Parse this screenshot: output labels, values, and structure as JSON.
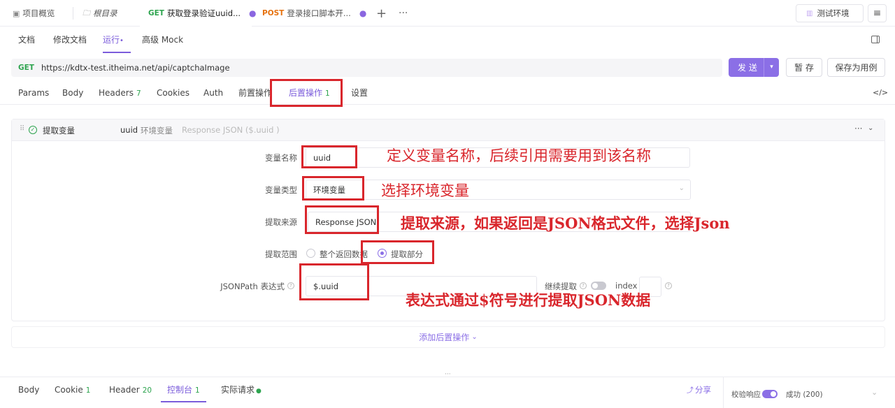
{
  "top_tabs": [
    {
      "icon": "overview-icon",
      "label": "项目概览"
    },
    {
      "icon": "folder-icon",
      "label": "根目录"
    },
    {
      "method": "GET",
      "label": "获取登录验证uuid..."
    },
    {
      "method": "POST",
      "label": "登录接口脚本开..."
    }
  ],
  "env": {
    "label": "测试环境"
  },
  "sub_tabs": [
    "文档",
    "修改文档",
    "运行",
    "高级 Mock"
  ],
  "active_sub_tab_dot": "•",
  "url": {
    "method": "GET",
    "value": "https://kdtx-test.itheima.net/api/captchaImage"
  },
  "buttons": {
    "send": "发 送",
    "save_temp": "暂 存",
    "save_case": "保存为用例"
  },
  "req_tabs": [
    {
      "label": "Params"
    },
    {
      "label": "Body"
    },
    {
      "label": "Headers",
      "count": "7"
    },
    {
      "label": "Cookies"
    },
    {
      "label": "Auth"
    },
    {
      "label": "前置操作"
    },
    {
      "label": "后置操作",
      "count": "1"
    },
    {
      "label": "设置"
    }
  ],
  "extract": {
    "title": "提取变量",
    "summary_var": "uuid",
    "summary_type": "环境变量",
    "summary_expr": "Response JSON ($.uuid )",
    "var_name_label": "变量名称",
    "var_name_value": "uuid",
    "var_type_label": "变量类型",
    "var_type_value": "环境变量",
    "source_label": "提取来源",
    "source_value": "Response JSON",
    "scope_label": "提取范围",
    "scope_all": "整个返回数据",
    "scope_part": "提取部分",
    "jsonpath_label": "JSONPath 表达式",
    "jsonpath_value": "$.uuid",
    "continue_label": "继续提取",
    "index_label": "index"
  },
  "annotations": {
    "a1": "定义变量名称，后续引用需要用到该名称",
    "a2": "选择环境变量",
    "a3": "提取来源，如果返回是JSON格式文件，选择Json",
    "a4": "表达式通过$符号进行提取JSON数据"
  },
  "add_post_op": "添加后置操作",
  "bottom_tabs": [
    {
      "label": "Body"
    },
    {
      "label": "Cookie",
      "count": "1"
    },
    {
      "label": "Header",
      "count": "20"
    },
    {
      "label": "控制台",
      "count": "1"
    },
    {
      "label": "实际请求"
    }
  ],
  "share": "分享",
  "verify_label": "校验响应",
  "status": "成功 (200)",
  "colors": {
    "accent": "#8b6fe6",
    "annotation": "#d9262c",
    "get": "#2ea44f",
    "post": "#e6720f"
  }
}
